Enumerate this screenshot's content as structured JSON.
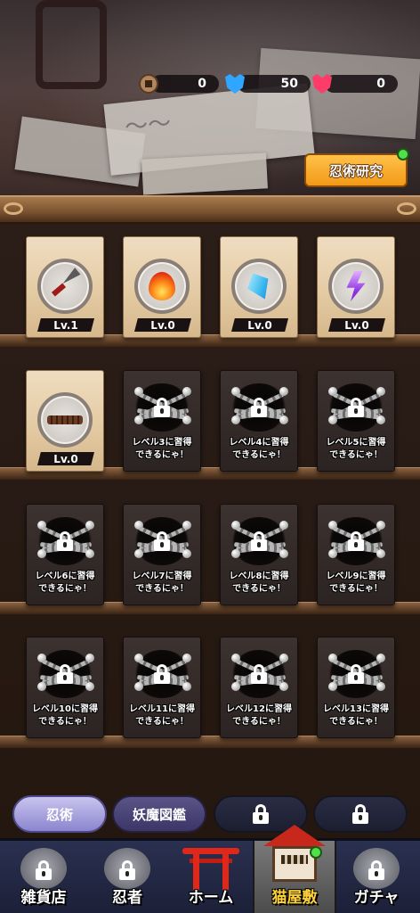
{
  "currency": {
    "coins": {
      "icon": "coin-icon",
      "value": "0"
    },
    "blue": {
      "icon": "blue-gem-icon",
      "value": "50"
    },
    "red": {
      "icon": "red-gem-icon",
      "value": "0"
    }
  },
  "research_button": {
    "label": "忍術研究",
    "notification": true
  },
  "skills": [
    {
      "state": "unlocked",
      "icon": "kunai-icon",
      "level": "Lv.1"
    },
    {
      "state": "unlocked",
      "icon": "fire-icon",
      "level": "Lv.0"
    },
    {
      "state": "unlocked",
      "icon": "ice-crystal-icon",
      "level": "Lv.0"
    },
    {
      "state": "unlocked",
      "icon": "lightning-icon",
      "level": "Lv.0"
    },
    {
      "state": "unlocked",
      "icon": "spike-trap-icon",
      "level": "Lv.0"
    },
    {
      "state": "locked",
      "text": "レベル3に習得\nできるにゃ！"
    },
    {
      "state": "locked",
      "text": "レベル4に習得\nできるにゃ！"
    },
    {
      "state": "locked",
      "text": "レベル5に習得\nできるにゃ！"
    },
    {
      "state": "locked",
      "text": "レベル6に習得\nできるにゃ！"
    },
    {
      "state": "locked",
      "text": "レベル7に習得\nできるにゃ！"
    },
    {
      "state": "locked",
      "text": "レベル8に習得\nできるにゃ！"
    },
    {
      "state": "locked",
      "text": "レベル9に習得\nできるにゃ！"
    },
    {
      "state": "locked",
      "text": "レベル10に習得\nできるにゃ！"
    },
    {
      "state": "locked",
      "text": "レベル11に習得\nできるにゃ！"
    },
    {
      "state": "locked",
      "text": "レベル12に習得\nできるにゃ！"
    },
    {
      "state": "locked",
      "text": "レベル13に習得\nできるにゃ！"
    }
  ],
  "sub_tabs": [
    {
      "label": "忍術",
      "state": "active"
    },
    {
      "label": "妖魔図鑑",
      "state": "normal"
    },
    {
      "label": "",
      "state": "locked"
    },
    {
      "label": "",
      "state": "locked"
    }
  ],
  "bottom_nav": [
    {
      "label": "雑貨店",
      "icon": "shop-icon",
      "locked": true
    },
    {
      "label": "忍者",
      "icon": "ninja-icon",
      "locked": true
    },
    {
      "label": "ホーム",
      "icon": "torii-icon",
      "locked": false
    },
    {
      "label": "猫屋敷",
      "icon": "cat-house-icon",
      "locked": false,
      "active": true,
      "notification": true
    },
    {
      "label": "ガチャ",
      "icon": "gacha-icon",
      "locked": true
    }
  ],
  "colors": {
    "accent_orange": "#f39a18",
    "notification_green": "#52e04a",
    "tab_active": "#8b85cf"
  }
}
